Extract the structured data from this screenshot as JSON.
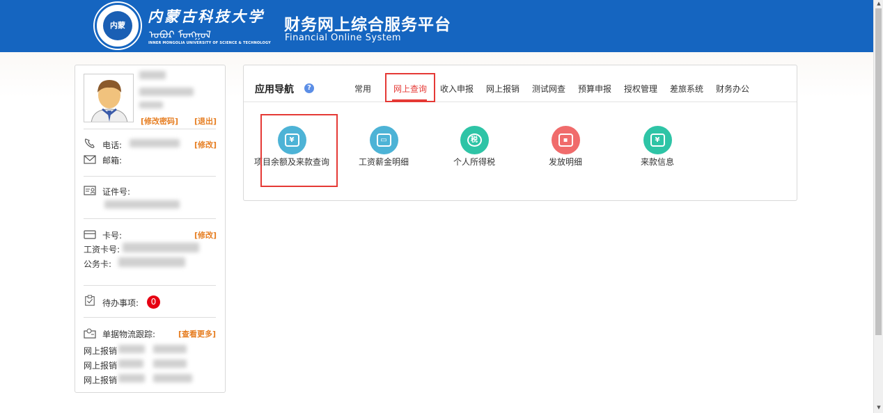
{
  "header": {
    "logo_text": "内蒙",
    "university_cn": "内蒙古科技大学",
    "university_mongol": "ᠣᠪᠦᠷ ᠮᠣᠩᠭᠣᠯ",
    "university_en": "INNER MONGOLIA UNIVERSITY OF SCIENCE & TECHNOLOGY",
    "system_title": "财务网上综合服务平台",
    "system_subtitle": "Financial  Online  System"
  },
  "profile": {
    "change_password": "[修改密码]",
    "logout": "[退出]",
    "phone_label": "电话:",
    "phone_edit": "[修改]",
    "email_label": "邮箱:",
    "id_label": "证件号:",
    "card_label": "卡号:",
    "card_edit": "[修改]",
    "salary_card_label": "工资卡号:",
    "official_card_label": "公务卡:",
    "todo_label": "待办事项:",
    "todo_count": "0",
    "tracking_label": "单据物流跟踪:",
    "tracking_more": "[查看更多]",
    "tracking_items": [
      "网上报销",
      "网上报销",
      "网上报销"
    ]
  },
  "nav": {
    "title": "应用导航",
    "help": "?",
    "tabs": [
      "常用",
      "网上查询",
      "收入申报",
      "网上报销",
      "测试网查",
      "预算申报",
      "授权管理",
      "差旅系统",
      "财务办公"
    ],
    "active_tab": "网上查询",
    "apps": [
      {
        "name": "项目余额及来款查询",
        "icon": "yuan-ticket-icon",
        "color": "#4db3d6"
      },
      {
        "name": "工资薪金明细",
        "icon": "salary-box-icon",
        "color": "#4db3d6"
      },
      {
        "name": "个人所得税",
        "icon": "tax-search-icon",
        "color": "#2ec4a6"
      },
      {
        "name": "发放明细",
        "icon": "wallet-icon",
        "color": "#f06b6b"
      },
      {
        "name": "来款信息",
        "icon": "yuan-shield-icon",
        "color": "#2ec4a6"
      }
    ]
  }
}
